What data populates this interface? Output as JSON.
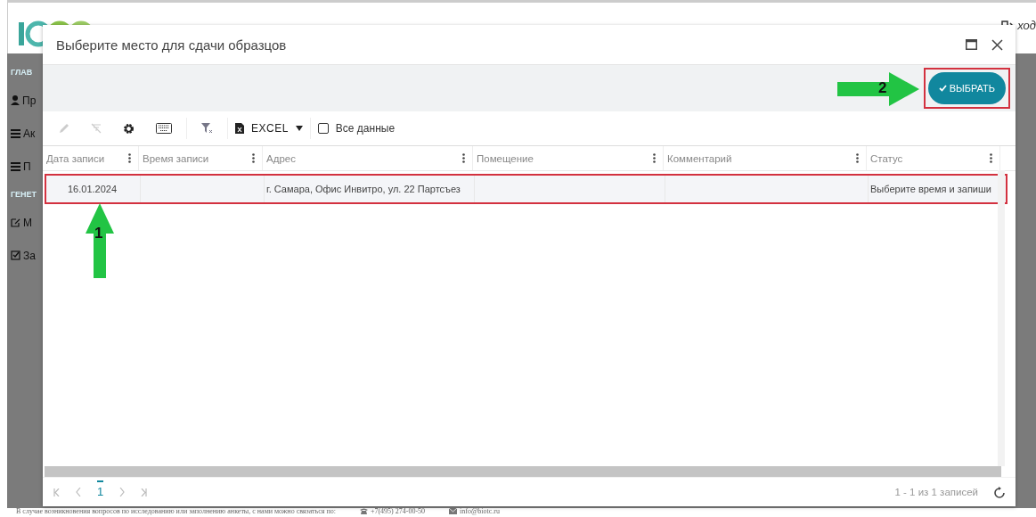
{
  "page": {
    "sidebar": [
      {
        "kind": "heading",
        "text": "ГЛАВ"
      },
      {
        "kind": "user",
        "text": "Пр"
      },
      {
        "kind": "list",
        "text": "Ак"
      },
      {
        "kind": "list",
        "text": "П"
      },
      {
        "kind": "heading",
        "text": "ГЕНЕТ"
      },
      {
        "kind": "edit",
        "text": "М"
      },
      {
        "kind": "check",
        "text": "За"
      }
    ],
    "exit_label": "ход",
    "footer": {
      "note": "В случае возникновения вопросов по исследованию или заполнению анкеты, с нами можно связаться по:",
      "phone": "+7(495) 274-00-50",
      "email": "info@biotc.ru"
    }
  },
  "dialog": {
    "title": "Выберите место для сдачи образцов",
    "select_button": "ВЫБРАТЬ",
    "toolbar": {
      "export_label": "EXCEL",
      "all_data": {
        "label": "Все данные",
        "checked": false
      }
    },
    "table": {
      "columns": [
        "Дата записи",
        "Время записи",
        "Адрес",
        "Помещение",
        "Комментарий",
        "Статус"
      ],
      "rows": [
        {
          "selected": true,
          "date": "16.01.2024",
          "address": "г. Самара, Офис Инвитро, ул. 22 Партсъез",
          "status": "Выберите время и запиши"
        }
      ]
    },
    "pager": {
      "current_page": "1",
      "summary": "1 - 1 из 1 записей"
    }
  },
  "annotations": [
    {
      "kind": "up",
      "number": "1"
    },
    {
      "kind": "right",
      "number": "2"
    }
  ]
}
